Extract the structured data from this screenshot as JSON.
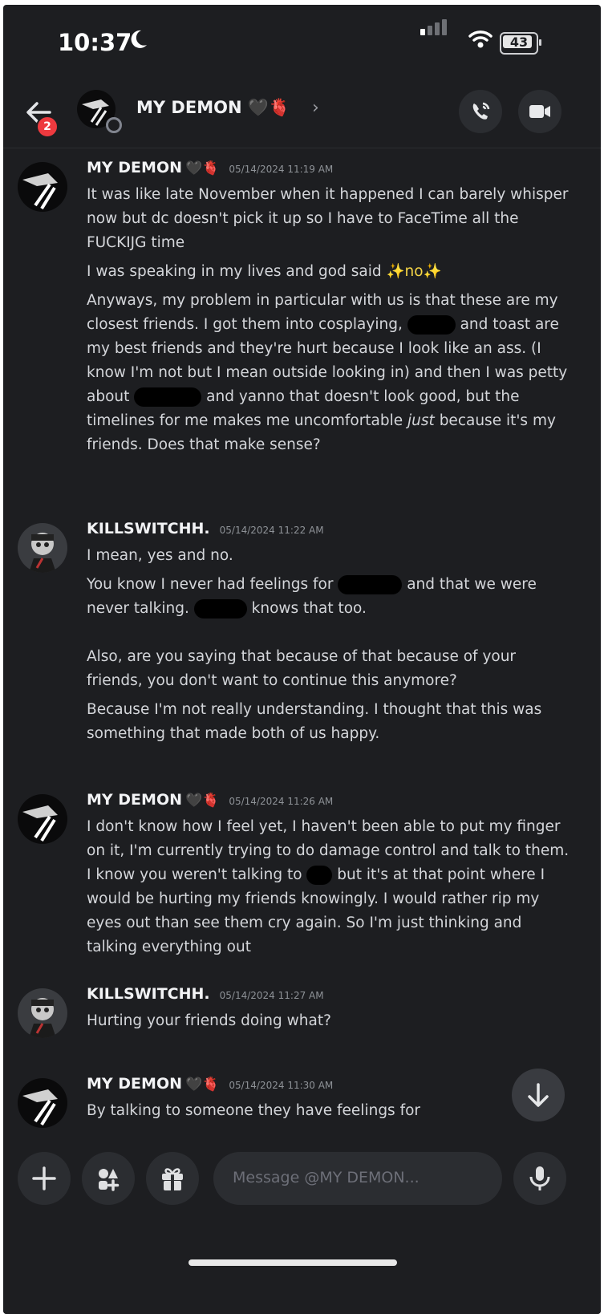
{
  "status_bar": {
    "time": "10:37",
    "battery": "43"
  },
  "header": {
    "back_badge": "2",
    "title": "MY DEMON 🖤🫀"
  },
  "messages": [
    {
      "author": "MY DEMON",
      "author_suffix": "🖤🫀",
      "timestamp": "05/14/2024 11:19 AM",
      "paragraphs": {
        "p1": "It was like late November when it happened I can barely whisper now but dc doesn't pick it up so I have to FaceTime all the FUCKIJG time",
        "p2_a": "I was speaking in my lives and god said ",
        "p2_b": "✨no✨",
        "p3_a": "Anyways, my problem in particular with us is that these are my closest friends. I got them into cosplaying, ",
        "p3_b": " and toast are my best friends and they're hurt because I look like an ass. (I know I'm not but I mean outside looking in) and then I was petty about ",
        "p3_c": " and yanno that doesn't look good, but the timelines for me makes me uncomfortable ",
        "p3_em": "just",
        "p3_d": " because it's my friends. Does that make sense?"
      }
    },
    {
      "author": "KILLSWITCHH.",
      "timestamp": "05/14/2024 11:22 AM",
      "paragraphs": {
        "p1": "I mean, yes and no.",
        "p2_a": "You know I never had feelings for ",
        "p2_b": " and that we were never talking. ",
        "p2_c": " knows that too.",
        "p3": "Also, are you saying that because of that because of your friends, you don't want to continue this anymore?",
        "p4": "Because I'm not really understanding. I thought that this was something that made both of us happy."
      }
    },
    {
      "author": "MY DEMON",
      "author_suffix": "🖤🫀",
      "timestamp": "05/14/2024 11:26 AM",
      "paragraphs": {
        "p1_a": "I don't know how I feel yet, I haven't been able to put my finger on it, I'm currently trying to do damage control and talk to them. I know you weren't talking to ",
        "p1_b": " but it's at that point where I would be hurting my friends knowingly. I would rather rip my eyes out than see them cry again. So I'm just thinking and talking everything out"
      }
    },
    {
      "author": "KILLSWITCHH.",
      "timestamp": "05/14/2024 11:27 AM",
      "paragraphs": {
        "p1": "Hurting your friends doing what?"
      }
    },
    {
      "author": "MY DEMON",
      "author_suffix": "🖤🫀",
      "timestamp": "05/14/2024 11:30 AM",
      "paragraphs": {
        "p1": "By talking to someone they have feelings for"
      }
    }
  ],
  "composer": {
    "placeholder": "Message @MY DEMON..."
  },
  "colors": {
    "background": "#1d1e21",
    "surface": "#2b2d31",
    "badge": "#ee3a3f",
    "text": "#dbdee1"
  },
  "icons": [
    "back-arrow-icon",
    "phone-call-icon",
    "video-camera-icon",
    "plus-icon",
    "apps-icon",
    "gift-icon",
    "emoji-icon",
    "microphone-icon",
    "arrow-down-icon",
    "moon-icon",
    "signal-icon",
    "wifi-icon",
    "battery-icon"
  ]
}
